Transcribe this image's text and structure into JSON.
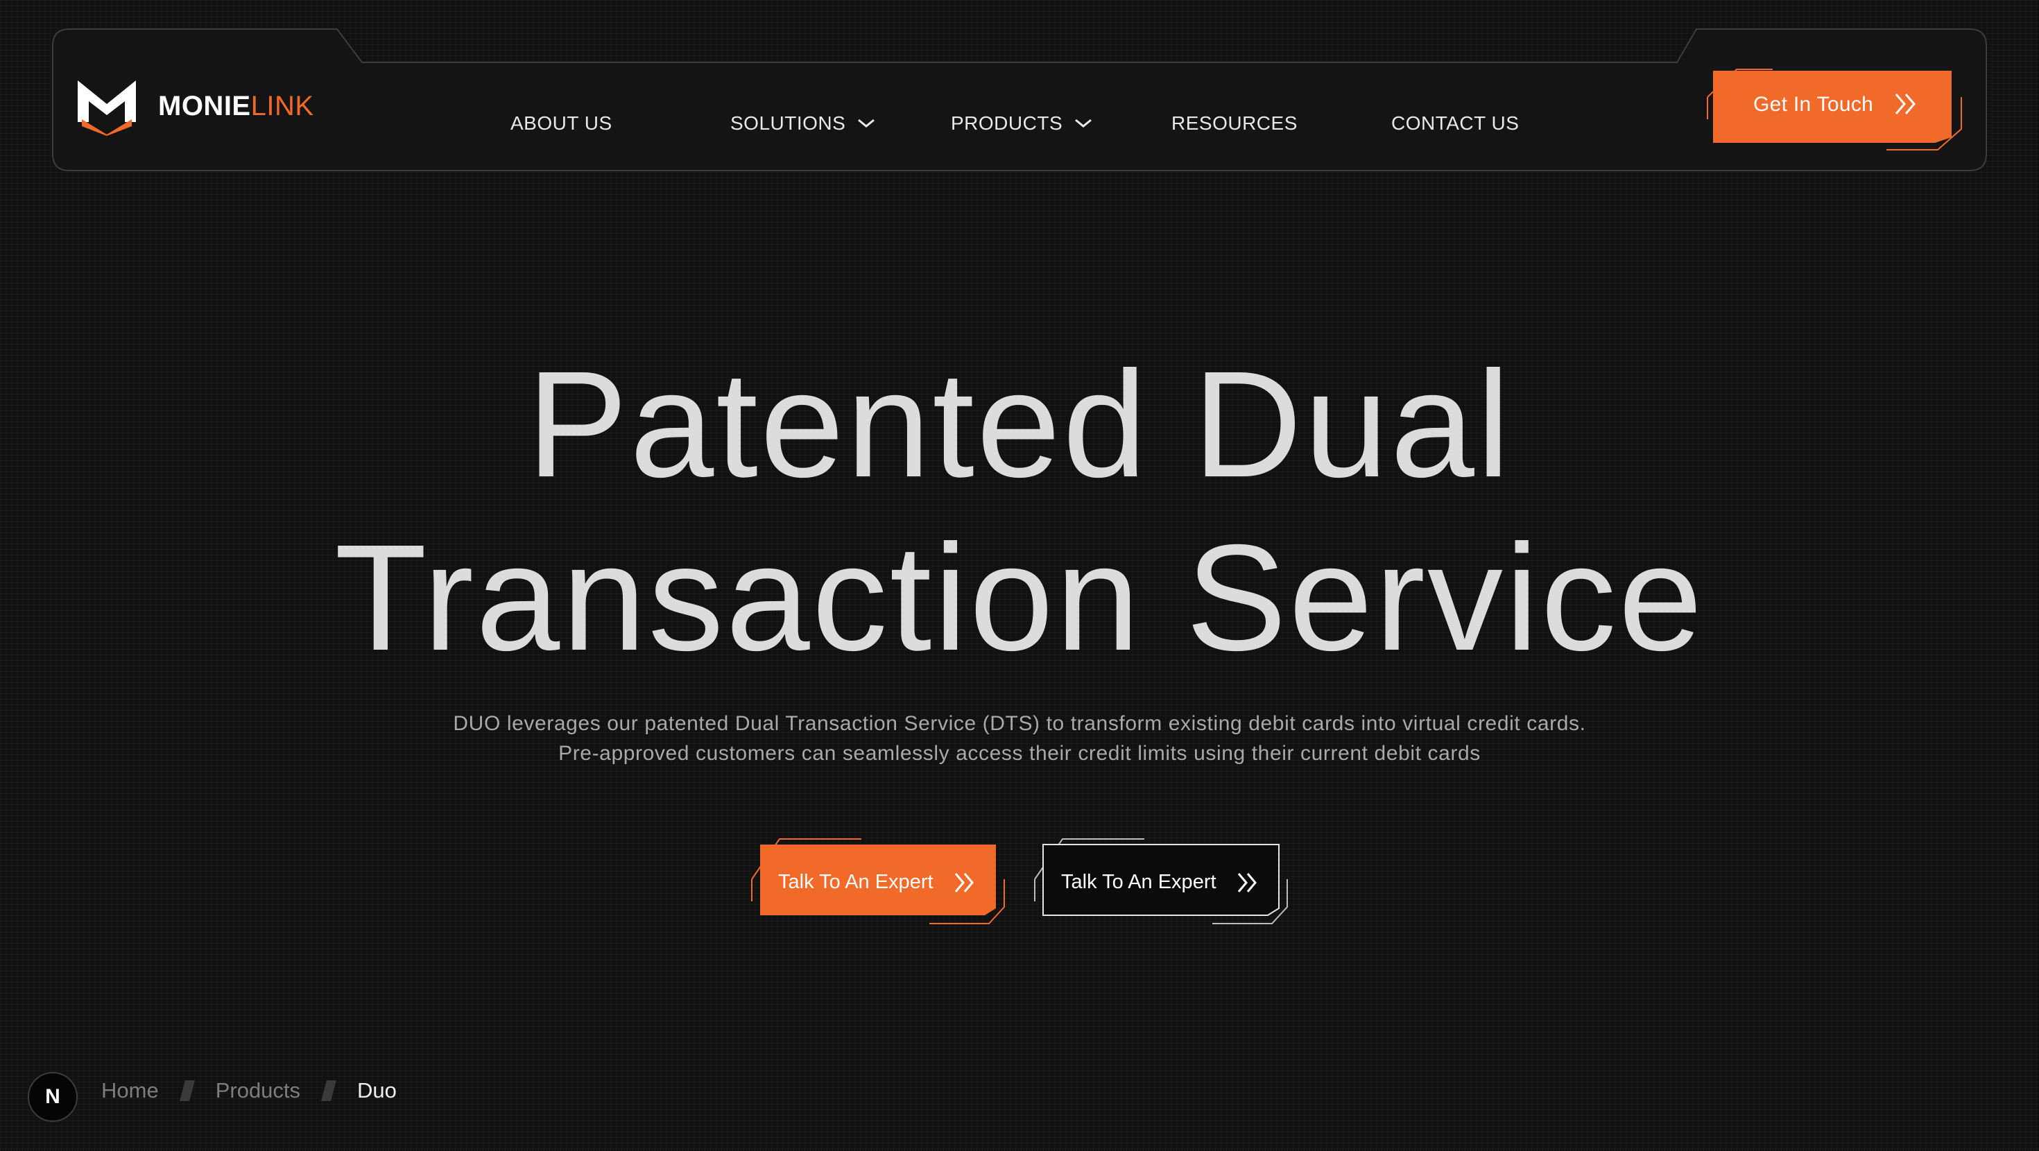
{
  "colors": {
    "accent": "#f26a2a",
    "background": "#111111",
    "text_primary": "#dcdcdc",
    "text_muted": "#a9a9a9"
  },
  "brand": {
    "name_bold": "MONIE",
    "name_light": "LINK",
    "logo_icon": "m-logo-icon"
  },
  "nav": {
    "items": [
      {
        "label": "ABOUT US",
        "has_dropdown": false
      },
      {
        "label": "SOLUTIONS",
        "has_dropdown": true
      },
      {
        "label": "PRODUCTS",
        "has_dropdown": true
      },
      {
        "label": "RESOURCES",
        "has_dropdown": false
      },
      {
        "label": "CONTACT US",
        "has_dropdown": false
      }
    ],
    "cta_label": "Get In Touch",
    "cta_icon": "double-chevron-right-icon"
  },
  "hero": {
    "title_line1": "Patented Dual",
    "title_line2": "Transaction Service",
    "description": "DUO leverages our patented Dual Transaction Service (DTS) to transform existing debit cards into virtual credit cards. Pre-approved customers can seamlessly access their credit limits using their current debit cards",
    "primary_button": "Talk To An Expert",
    "secondary_button": "Talk To An Expert"
  },
  "breadcrumb": {
    "badge": "N",
    "items": [
      "Home",
      "Products",
      "Duo"
    ]
  }
}
